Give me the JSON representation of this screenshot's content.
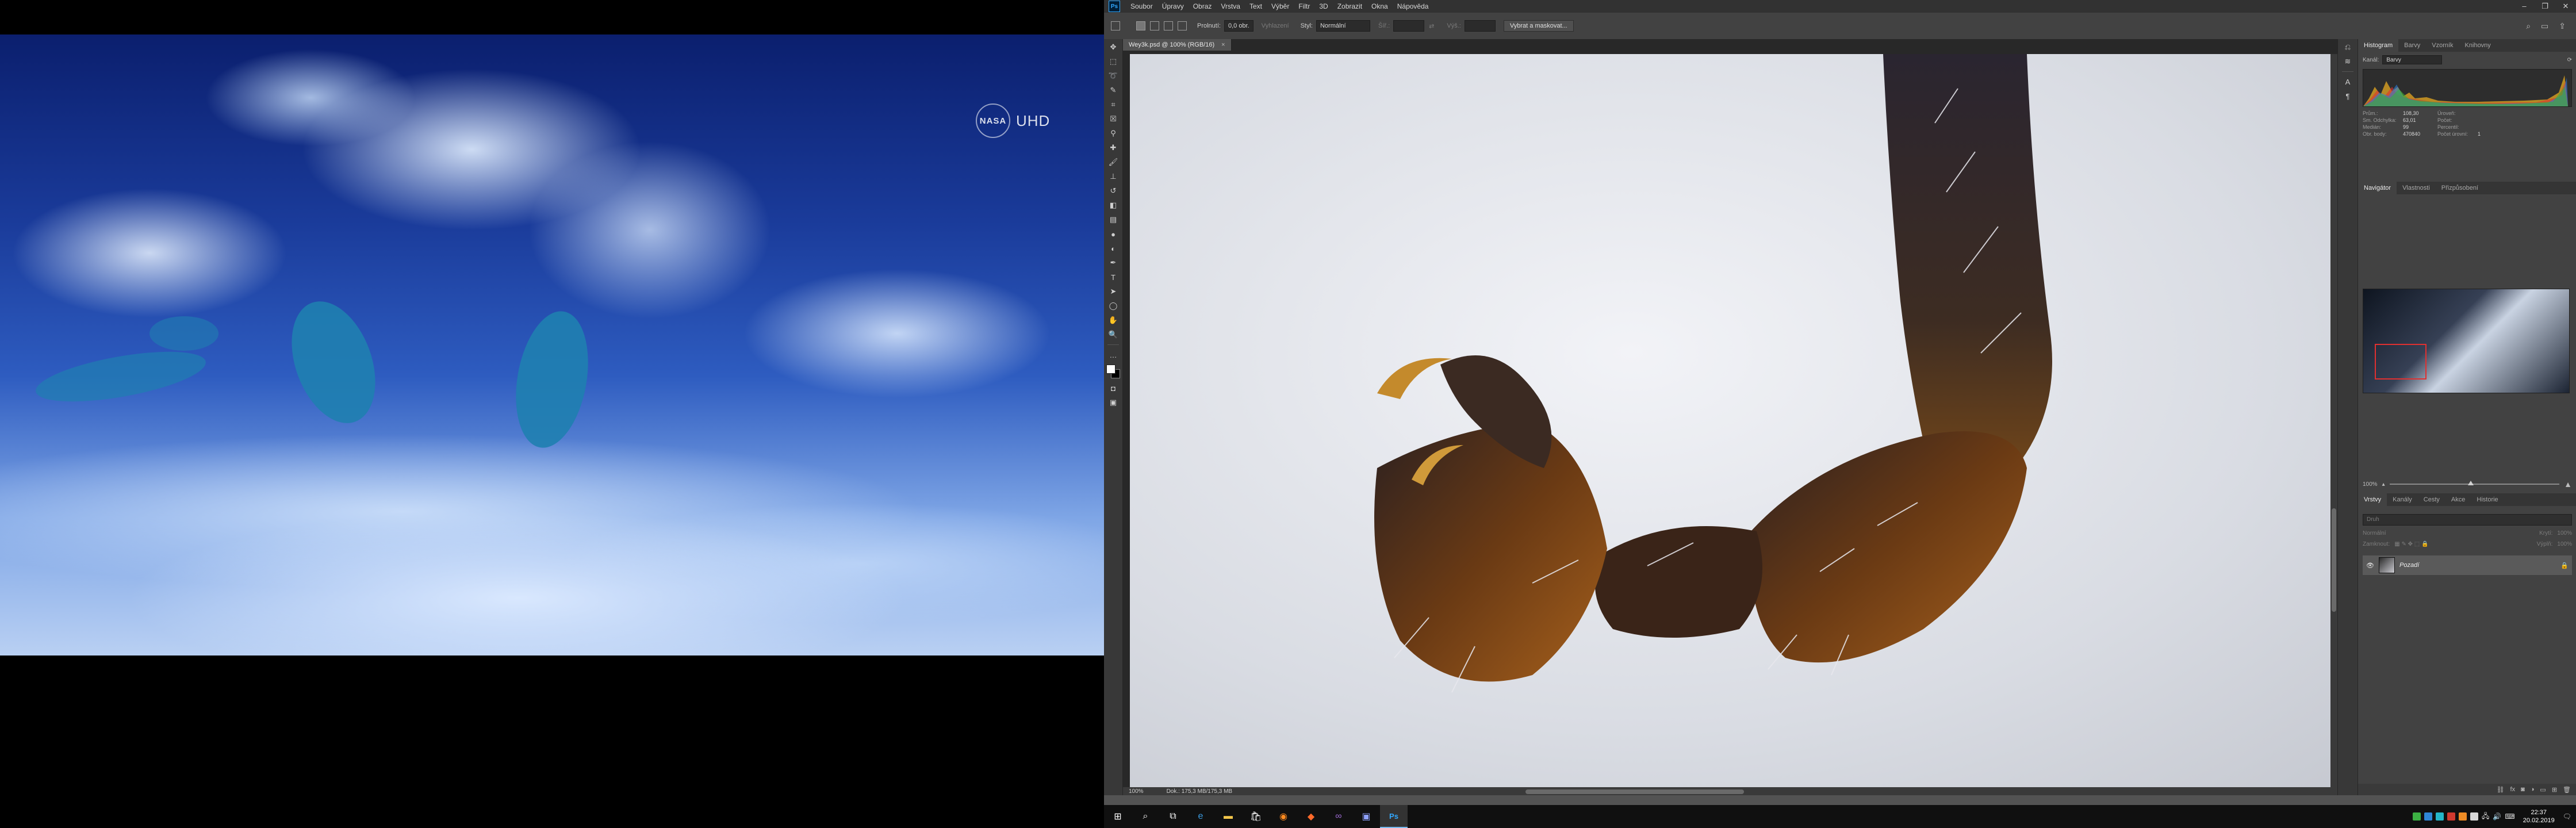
{
  "left_monitor": {
    "video": {
      "logo_text": "NASA",
      "badge": "UHD"
    }
  },
  "photoshop": {
    "app_icon": "Ps",
    "menu": [
      "Soubor",
      "Úpravy",
      "Obraz",
      "Vrstva",
      "Text",
      "Výběr",
      "Filtr",
      "3D",
      "Zobrazit",
      "Okna",
      "Nápověda"
    ],
    "window_controls": [
      "–",
      "❐",
      "✕"
    ],
    "options_bar": {
      "feather_label": "Prolnutí:",
      "feather_value": "0,0 obr.",
      "antialias_label": "Vyhlazení",
      "style_label": "Styl:",
      "style_value": "Normální",
      "width_label": "Šíř.:",
      "height_label": "Výš.:",
      "select_mask_button": "Vybrat a maskovat..."
    },
    "document_tab": {
      "title": "Wey3k.psd @ 100% (RGB/16)",
      "close": "×"
    },
    "status": {
      "zoom": "100%",
      "doc_size": "Dok.: 175,3 MB/175,3 MB"
    },
    "panels": {
      "top_tabs": [
        "Histogram",
        "Barvy",
        "Vzorník",
        "Knihovny"
      ],
      "histogram": {
        "channel_label": "Kanál:",
        "channel_value": "Barvy",
        "stats": [
          [
            "Prům.:",
            "108,30",
            "Úroveň:",
            ""
          ],
          [
            "Sm. Odchylka:",
            "63,01",
            "Počet:",
            ""
          ],
          [
            "Medián:",
            "99",
            "Percentil:",
            ""
          ],
          [
            "Obr. body:",
            "470840",
            "Počet úrovní:",
            "1"
          ]
        ]
      },
      "nav_tabs": [
        "Navigátor",
        "Vlastnosti",
        "Přizpůsobení"
      ],
      "navigator": {
        "zoom": "100%"
      },
      "layers_tabs": [
        "Vrstvy",
        "Kanály",
        "Cesty",
        "Akce",
        "Historie"
      ],
      "layers": {
        "search_placeholder": "Druh",
        "blend_mode": "Normální",
        "opacity_label": "Krytí:",
        "opacity_value": "100%",
        "lock_label": "Zamknout:",
        "fill_label": "Výplň:",
        "fill_value": "100%",
        "layer_name": "Pozadí"
      }
    }
  },
  "taskbar": {
    "clock_time": "22:37",
    "clock_date": "20.02.2019"
  },
  "colors": {
    "ps_bg": "#535353",
    "ps_menubar": "#323232",
    "ps_accent": "#31a8ff",
    "nav_view_box": "#e03030"
  }
}
